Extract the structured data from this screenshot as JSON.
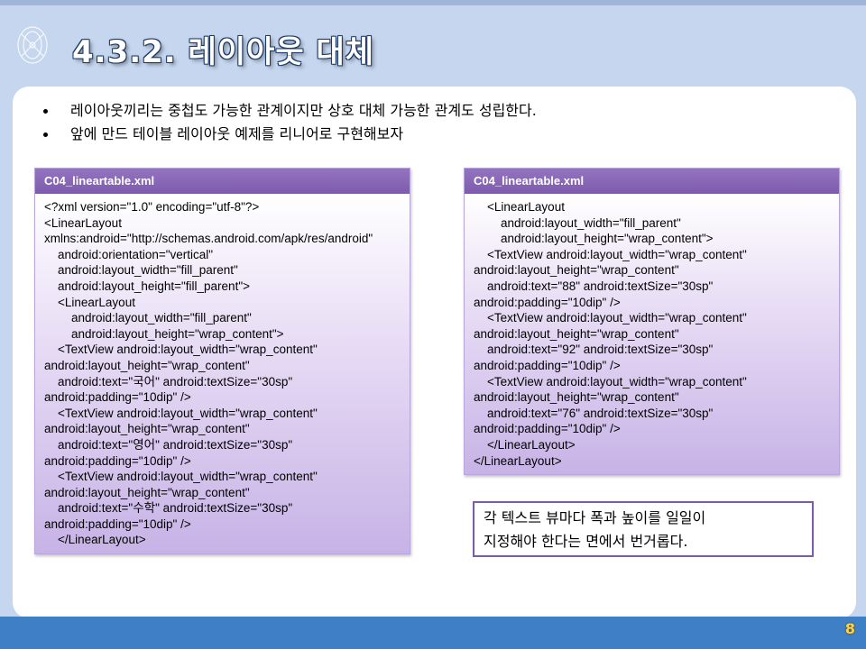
{
  "slide": {
    "title": "4.3.2. 레이아웃 대체",
    "bullets": [
      "레이아웃끼리는 중첩도 가능한 관계이지만 상호 대체 가능한 관계도 성립한다.",
      "앞에 만드 테이블 레이아웃 예제를 리니어로 구현해보자"
    ],
    "left_panel": {
      "header": "C04_lineartable.xml",
      "lines": [
        "<?xml version=\"1.0\" encoding=\"utf-8\"?>",
        "<LinearLayout",
        "xmlns:android=\"http://schemas.android.com/apk/res/android\"",
        "    android:orientation=\"vertical\"",
        "    android:layout_width=\"fill_parent\"",
        "    android:layout_height=\"fill_parent\">",
        "    <LinearLayout",
        "        android:layout_width=\"fill_parent\"",
        "        android:layout_height=\"wrap_content\">",
        "    <TextView android:layout_width=\"wrap_content\"",
        "android:layout_height=\"wrap_content\"",
        "    android:text=\"국어\" android:textSize=\"30sp\"",
        "android:padding=\"10dip\" />",
        "    <TextView android:layout_width=\"wrap_content\"",
        "android:layout_height=\"wrap_content\"",
        "    android:text=\"영어\" android:textSize=\"30sp\"",
        "android:padding=\"10dip\" />",
        "    <TextView android:layout_width=\"wrap_content\"",
        "android:layout_height=\"wrap_content\"",
        "    android:text=\"수학\" android:textSize=\"30sp\"",
        "android:padding=\"10dip\" />",
        "    </LinearLayout>"
      ]
    },
    "right_panel": {
      "header": "C04_lineartable.xml",
      "lines": [
        "    <LinearLayout",
        "        android:layout_width=\"fill_parent\"",
        "        android:layout_height=\"wrap_content\">",
        "    <TextView android:layout_width=\"wrap_content\"",
        "android:layout_height=\"wrap_content\"",
        "    android:text=\"88\" android:textSize=\"30sp\"",
        "android:padding=\"10dip\" />",
        "    <TextView android:layout_width=\"wrap_content\"",
        "android:layout_height=\"wrap_content\"",
        "    android:text=\"92\" android:textSize=\"30sp\"",
        "android:padding=\"10dip\" />",
        "    <TextView android:layout_width=\"wrap_content\"",
        "android:layout_height=\"wrap_content\"",
        "    android:text=\"76\" android:textSize=\"30sp\"",
        "android:padding=\"10dip\" />",
        "    </LinearLayout>",
        "</LinearLayout>"
      ]
    },
    "note": [
      "각 텍스트 뷰마다 폭과 높이를 일일이",
      "지정해야 한다는 면에서 번거롭다."
    ],
    "page_number": "8"
  },
  "colors": {
    "background": "#c5d6ee",
    "bottom_band": "#3f7fc5",
    "panel_header": "#7d5bab",
    "page_number": "#ffd24a"
  },
  "icons": [
    "decorative-logo-icon"
  ]
}
